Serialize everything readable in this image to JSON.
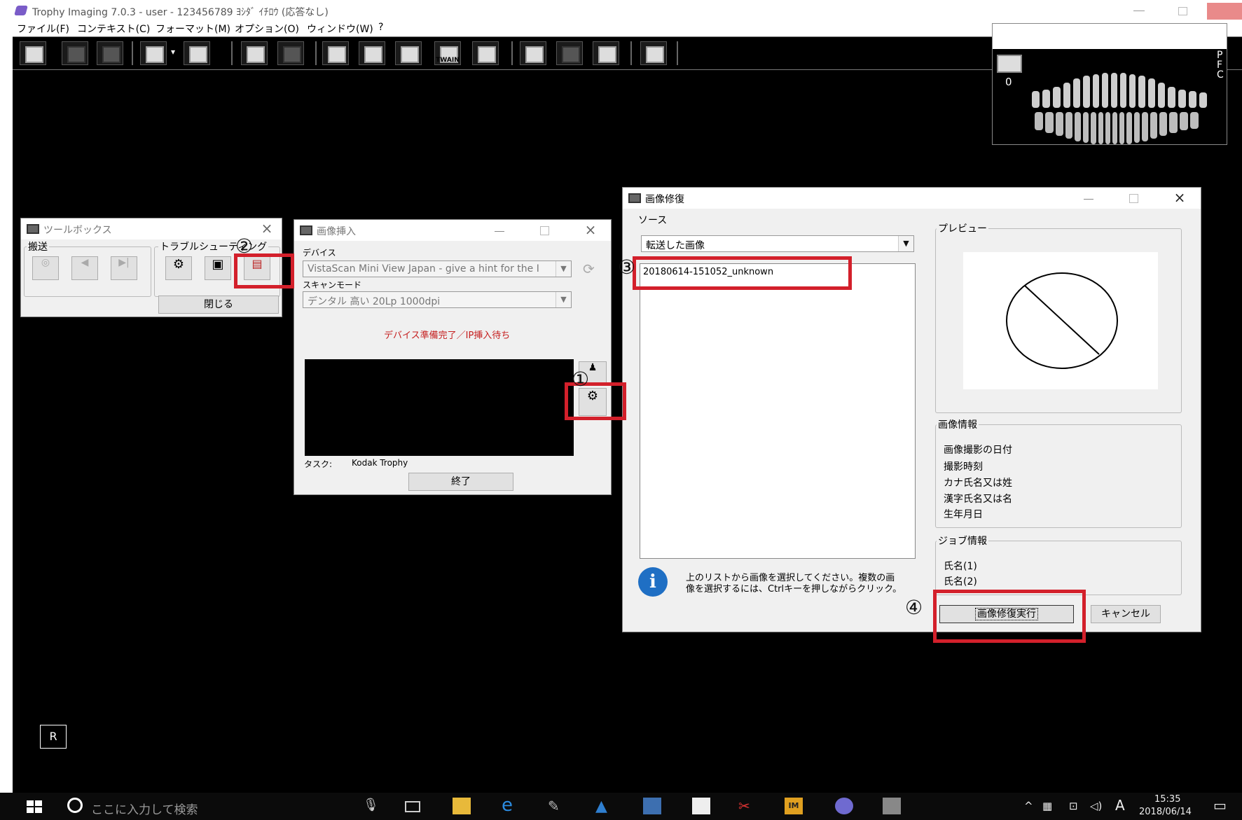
{
  "window": {
    "title": "Trophy Imaging 7.0.3 - user - 123456789 ﾖｼﾀﾞ ｲﾁﾛｳ (応答なし)"
  },
  "menu": [
    "ファイル(F)",
    "コンテキスト(C)",
    "フォーマット(M)",
    "オプション(O)",
    "ウィンドウ(W)",
    "?"
  ],
  "toolbar": {
    "twain_label": "TWAIN"
  },
  "thumbnail_panel": {
    "index": "0",
    "side_letters": "P F C"
  },
  "orientation_marker": "R",
  "toolbox": {
    "title": "ツールボックス",
    "group_transport": "搬送",
    "group_troubleshoot": "トラブルシューティング",
    "close_button": "閉じる"
  },
  "insert_dialog": {
    "title": "画像挿入",
    "device_label": "デバイス",
    "device_value": "VistaScan Mini View Japan - give a hint for the I",
    "scanmode_label": "スキャンモード",
    "scanmode_value": "デンタル 高い 20Lp 1000dpi",
    "status": "デバイス準備完了／IP挿入待ち",
    "task_label": "タスク:",
    "task_value": "Kodak Trophy",
    "end_button": "終了"
  },
  "repair_dialog": {
    "title": "画像修復",
    "source_label": "ソース",
    "source_value": "転送した画像",
    "list_items": [
      "20180614-151052_unknown"
    ],
    "info_text_1": "上のリストから画像を選択してください。複数の画",
    "info_text_2": "像を選択するには、Ctrlキーを押しながらクリック。",
    "preview_label": "プレビュー",
    "image_info_label": "画像情報",
    "image_info_fields": [
      "画像撮影の日付",
      "撮影時刻",
      "カナ氏名又は姓",
      "漢字氏名又は名",
      "生年月日"
    ],
    "job_info_label": "ジョブ情報",
    "job_info_fields": [
      "氏名(1)",
      "氏名(2)"
    ],
    "run_button": "画像修復実行",
    "cancel_button": "キャンセル"
  },
  "annotations": {
    "step1": "①",
    "step2": "②",
    "step3": "③",
    "step4": "④",
    "color": "#d3202b"
  },
  "taskbar": {
    "search_placeholder": "ここに入力して検索",
    "time": "15:35",
    "date": "2018/06/14",
    "ime": "A",
    "im_badge": "IM"
  }
}
